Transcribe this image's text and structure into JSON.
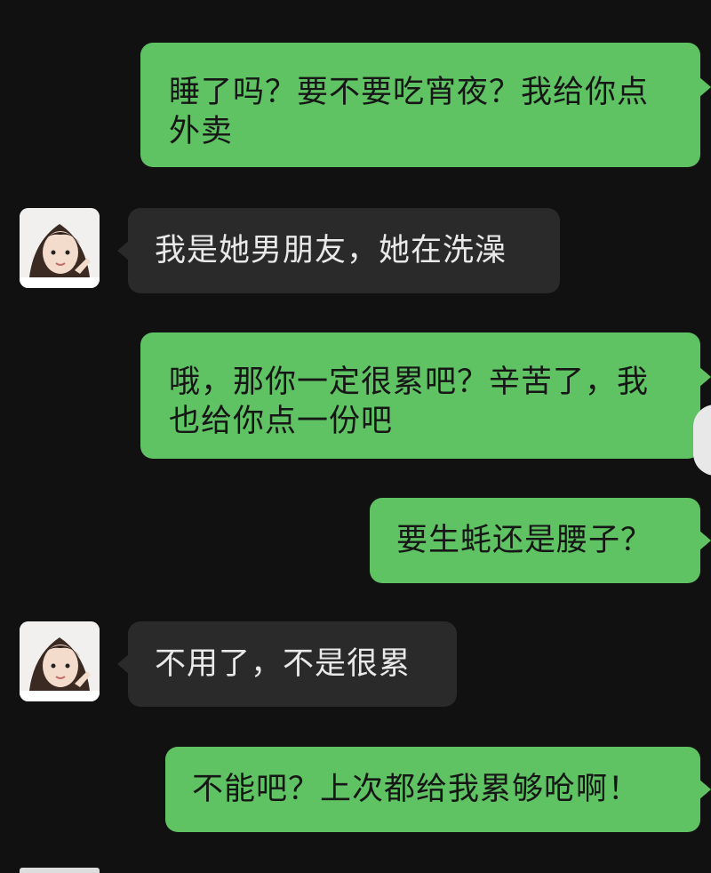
{
  "messages": [
    {
      "side": "out",
      "text": "睡了吗？要不要吃宵夜？我给你点\n外卖"
    },
    {
      "side": "in",
      "text": "我是她男朋友，她在洗澡",
      "avatar_icon": "girl-avatar-icon"
    },
    {
      "side": "out",
      "text": "哦，那你一定很累吧？辛苦了，我\n也给你点一份吧"
    },
    {
      "side": "out",
      "text": "要生蚝还是腰子？"
    },
    {
      "side": "in",
      "text": "不用了，不是很累",
      "avatar_icon": "girl-avatar-icon"
    },
    {
      "side": "out",
      "text": "不能吧？上次都给我累够呛啊！"
    }
  ],
  "colors": {
    "background": "#111111",
    "outgoing_bubble": "#5fc263",
    "incoming_bubble": "#2a2a2a",
    "incoming_text": "#e9e9e9",
    "outgoing_text": "#161616"
  }
}
